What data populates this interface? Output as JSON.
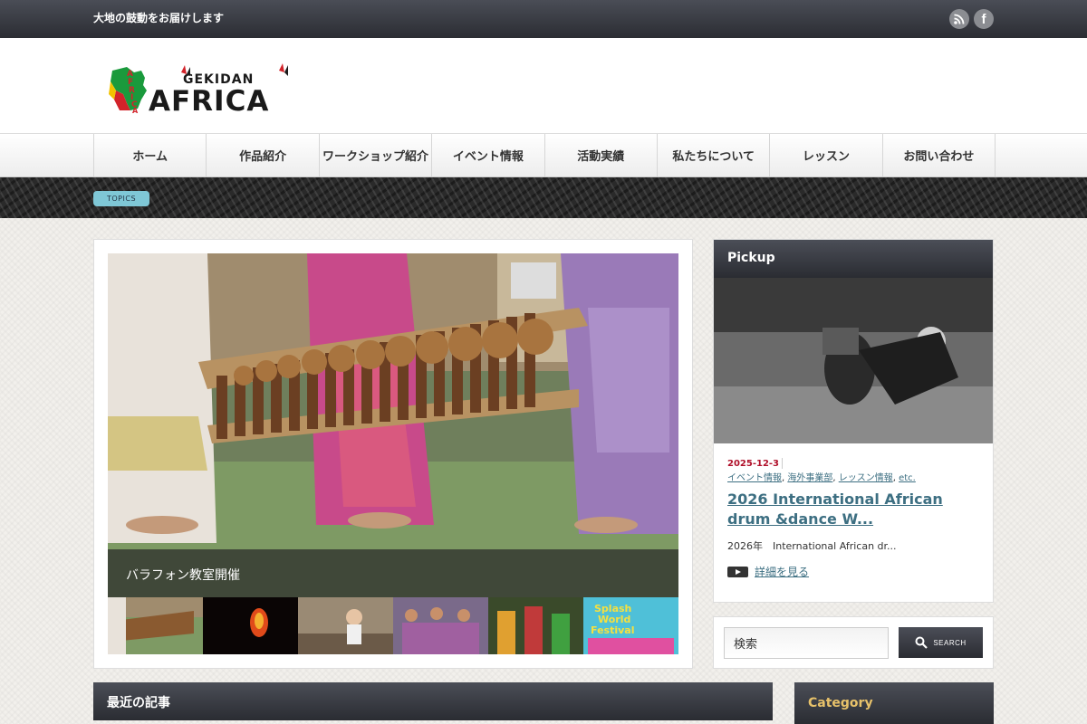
{
  "topbar": {
    "tagline": "大地の鼓動をお届けします",
    "social": [
      {
        "icon": "rss-icon"
      },
      {
        "icon": "facebook-icon",
        "glyph": "f"
      }
    ]
  },
  "logo": {
    "word_top": "GEKIDAN",
    "word_main": "AFRICA",
    "vertical_letters": [
      "A",
      "F",
      "R",
      "I",
      "C",
      "A"
    ],
    "colors": {
      "green": "#1a9a3c",
      "red": "#d2232a",
      "yellow": "#f2c200",
      "dark": "#1a1a1a"
    }
  },
  "nav": {
    "items": [
      {
        "label": "ホーム"
      },
      {
        "label": "作品紹介"
      },
      {
        "label": "ワークショップ紹介"
      },
      {
        "label": "イベント情報"
      },
      {
        "label": "活動実績"
      },
      {
        "label": "私たちについて"
      },
      {
        "label": "レッスン"
      },
      {
        "label": "お問い合わせ"
      }
    ]
  },
  "topics": {
    "badge": "TOPICS"
  },
  "slider": {
    "caption": "バラフォン教室開催",
    "thumbs": [
      {
        "name": "thumb-balafon"
      },
      {
        "name": "thumb-fire"
      },
      {
        "name": "thumb-child"
      },
      {
        "name": "thumb-group"
      },
      {
        "name": "thumb-festival"
      },
      {
        "name": "thumb-splash"
      }
    ],
    "splash_text": [
      "Splash",
      "World",
      "Festival"
    ]
  },
  "pickup": {
    "heading": "Pickup",
    "date": "2025-12-3",
    "categories": [
      "イベント情報",
      "海外事業部",
      "レッスン情報",
      "etc."
    ],
    "title": "2026 International African drum &dance W...",
    "excerpt": "2026年　International African dr...",
    "more_label": "詳細を見る"
  },
  "search": {
    "value": "検索",
    "button_label": "SEARCH"
  },
  "sections": {
    "recent": "最近の記事",
    "category": "Category"
  },
  "colors": {
    "accent_link": "#3d6f82",
    "date_red": "#b0102a",
    "topics_badge": "#7fc7d6",
    "category_gold": "#e8c26a"
  }
}
